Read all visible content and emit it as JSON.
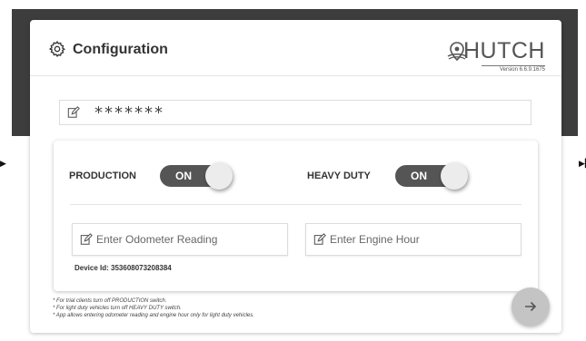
{
  "header": {
    "title": "Configuration",
    "logo_text": "HUTCH",
    "version": "Version 6.6.9.1675"
  },
  "password": {
    "value": "*******"
  },
  "settings": {
    "production": {
      "label": "PRODUCTION",
      "state": "ON"
    },
    "heavy_duty": {
      "label": "HEAVY DUTY",
      "state": "ON"
    },
    "odometer": {
      "placeholder": "Enter Odometer Reading",
      "value": ""
    },
    "engine_hour": {
      "placeholder": "Enter Engine Hour",
      "value": ""
    },
    "device_id": "Device Id: 353608073208384"
  },
  "notes": [
    "* For trial clients turn off PRODUCTION switch.",
    "* For light duty vehicles turn off HEAVY DUTY switch.",
    "* App allows entering odometer reading and engine hour only for light duty vehicles."
  ],
  "icons": {
    "gear": "gear-icon",
    "edit": "edit-icon",
    "next": "arrow-right-icon",
    "logo": "hutch-logo-icon"
  },
  "colors": {
    "header_band": "#3d3d3d",
    "toggle_track": "#555555",
    "next_button": "#c4c4c4"
  }
}
